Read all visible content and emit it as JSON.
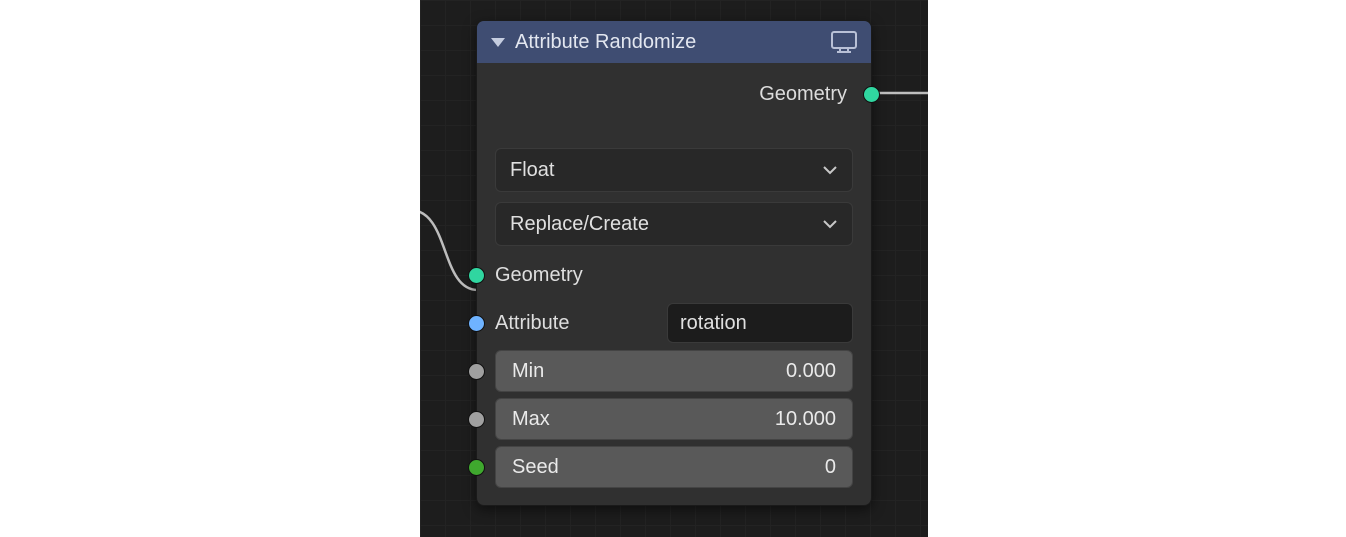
{
  "node": {
    "title": "Attribute Randomize",
    "outputs": {
      "geometry": {
        "label": "Geometry"
      }
    },
    "props": {
      "data_type": {
        "value": "Float"
      },
      "operation": {
        "value": "Replace/Create"
      }
    },
    "inputs": {
      "geometry": {
        "label": "Geometry"
      },
      "attribute": {
        "label": "Attribute",
        "value": "rotation"
      },
      "min": {
        "label": "Min",
        "value": "0.000"
      },
      "max": {
        "label": "Max",
        "value": "10.000"
      },
      "seed": {
        "label": "Seed",
        "value": "0"
      }
    }
  },
  "colors": {
    "geometry_socket": "#30d6a0",
    "string_socket": "#6fb3ff",
    "float_socket": "#a0a0a0",
    "int_socket": "#3fa82e"
  }
}
